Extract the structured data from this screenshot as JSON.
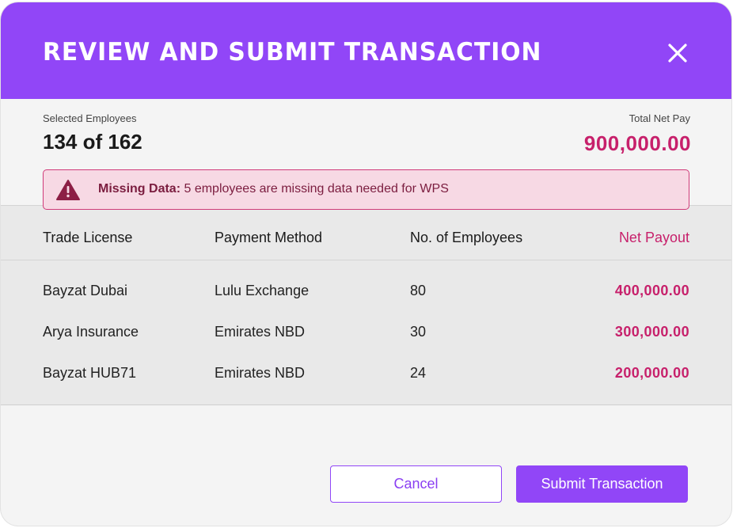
{
  "dialog": {
    "title": "REVIEW AND SUBMIT TRANSACTION",
    "close_icon": "close-icon"
  },
  "summary": {
    "selected_label": "Selected Employees",
    "selected_value": "134 of 162",
    "total_label": "Total Net Pay",
    "total_value": "900,000.00"
  },
  "alert": {
    "icon": "warning-triangle-icon",
    "strong": "Missing Data:",
    "message": "5 employees are missing data needed for WPS"
  },
  "table": {
    "headers": {
      "trade_license": "Trade License",
      "payment_method": "Payment Method",
      "employees": "No. of Employees",
      "net_payout": "Net Payout"
    },
    "rows": [
      {
        "trade_license": "Bayzat Dubai",
        "payment_method": "Lulu Exchange",
        "employees": "80",
        "net_payout": "400,000.00"
      },
      {
        "trade_license": "Arya Insurance",
        "payment_method": "Emirates NBD",
        "employees": "30",
        "net_payout": "300,000.00"
      },
      {
        "trade_license": "Bayzat HUB71",
        "payment_method": "Emirates NBD",
        "employees": "24",
        "net_payout": "200,000.00"
      }
    ]
  },
  "actions": {
    "cancel_label": "Cancel",
    "submit_label": "Submit Transaction"
  },
  "colors": {
    "header": "#9146f7",
    "accent_amount": "#c7206b",
    "alert_bg": "#f7d9e4",
    "alert_border": "#d03b79"
  }
}
